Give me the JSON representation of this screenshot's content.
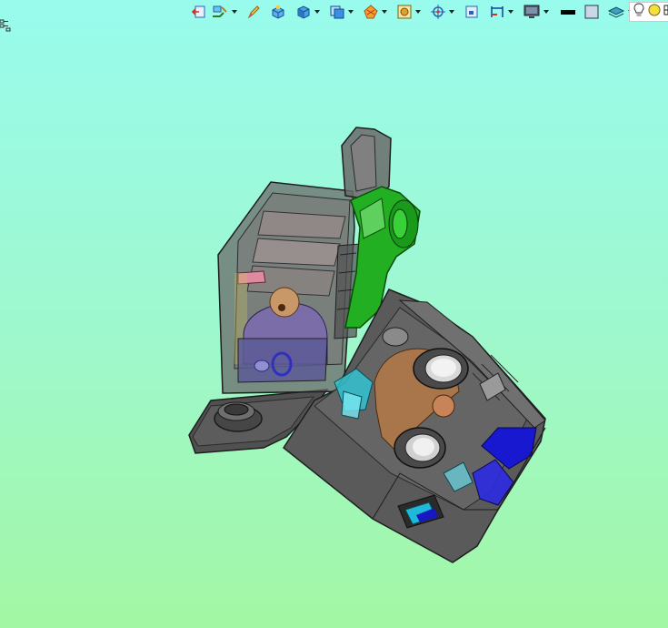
{
  "app": {
    "view": "3d-assembly-viewport"
  },
  "toolbar": {
    "buttons": [
      {
        "name": "exit-icon",
        "has_dropdown": false
      },
      {
        "name": "sketch-tool-icon",
        "has_dropdown": true
      },
      {
        "name": "pencil-icon",
        "has_dropdown": false
      },
      {
        "name": "extrude-icon",
        "has_dropdown": false
      },
      {
        "name": "cube-view-icon",
        "has_dropdown": true
      },
      {
        "name": "standard-views-icon",
        "has_dropdown": true
      },
      {
        "name": "render-style-icon",
        "has_dropdown": true
      },
      {
        "name": "fit-all-icon",
        "has_dropdown": true
      },
      {
        "name": "axis-system-icon",
        "has_dropdown": true
      },
      {
        "name": "measure-icon",
        "has_dropdown": false
      },
      {
        "name": "dimension-icon",
        "has_dropdown": true
      },
      {
        "name": "monitor-icon",
        "has_dropdown": true
      },
      {
        "name": "line-color-icon",
        "has_dropdown": false
      },
      {
        "name": "fill-color-icon",
        "has_dropdown": false
      },
      {
        "name": "layer-icon",
        "has_dropdown": true
      }
    ],
    "panel": [
      "lightbulb-icon",
      "light-source-icon",
      "grid-icon"
    ]
  },
  "colors": {
    "bg_top": "#98fbed",
    "bg_bottom": "#a2f7a4",
    "housing": "#5a5a5a",
    "green_part": "#22b022",
    "bronze_part": "#b07848",
    "blue_part": "#1818d0",
    "cyan_part": "#30c8d8",
    "purple_part": "#7a6ab0"
  }
}
